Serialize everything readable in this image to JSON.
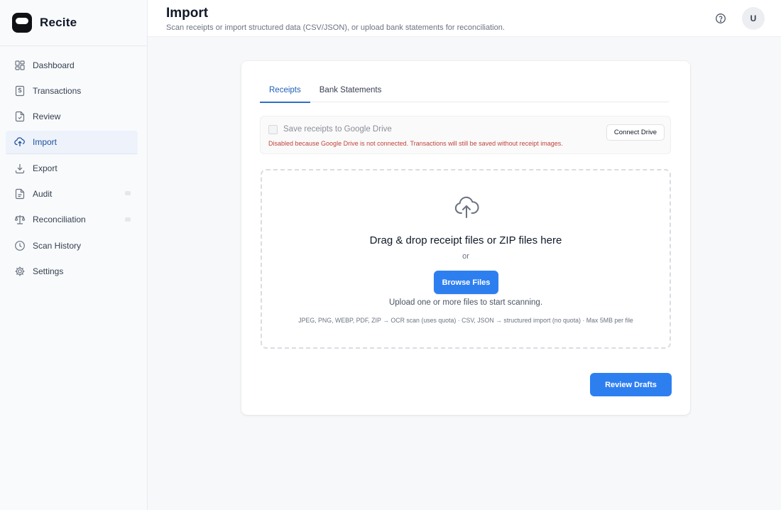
{
  "app": {
    "name": "Recite"
  },
  "sidebar": {
    "items": [
      {
        "label": "Dashboard",
        "icon": "grid-icon"
      },
      {
        "label": "Transactions",
        "icon": "dollar-receipt-icon"
      },
      {
        "label": "Review",
        "icon": "document-edit-icon"
      },
      {
        "label": "Import",
        "icon": "cloud-upload-icon",
        "active": true
      },
      {
        "label": "Export",
        "icon": "download-icon"
      },
      {
        "label": "Audit",
        "icon": "file-check-icon"
      },
      {
        "label": "Reconciliation",
        "icon": "scale-icon"
      },
      {
        "label": "Scan History",
        "icon": "clock-icon"
      },
      {
        "label": "Settings",
        "icon": "gear-icon"
      }
    ]
  },
  "header": {
    "title": "Import",
    "subtitle": "Scan receipts or import structured data (CSV/JSON), or upload bank statements for reconciliation.",
    "avatar_initial": "U"
  },
  "tabs": [
    {
      "label": "Receipts",
      "active": true
    },
    {
      "label": "Bank Statements",
      "active": false
    }
  ],
  "drive": {
    "checkbox_label": "Save receipts to Google Drive",
    "checked": false,
    "note": "Disabled because Google Drive is not connected. Transactions will still be saved without receipt images.",
    "connect_label": "Connect Drive"
  },
  "dropzone": {
    "title": "Drag & drop receipt files or ZIP files here",
    "or": "or",
    "browse_label": "Browse Files",
    "help": "Upload one or more files to start scanning.",
    "formats": "JPEG, PNG, WEBP, PDF, ZIP → OCR scan (uses quota) · CSV, JSON → structured import (no quota) · Max 5MB per file"
  },
  "actions": {
    "review_label": "Review Drafts"
  },
  "colors": {
    "accent": "#2d7ff0",
    "active_text": "#1e4f9c",
    "error_text": "#c0443b"
  }
}
